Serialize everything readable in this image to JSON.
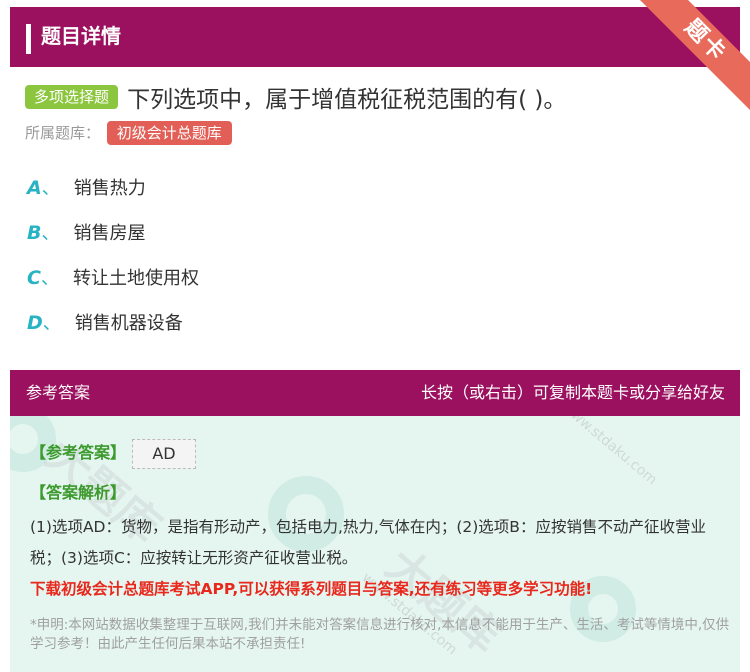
{
  "header": {
    "title": "题目详情"
  },
  "badge": {
    "label": "题卡"
  },
  "question": {
    "type": "多项选择题",
    "text": "下列选项中，属于增值税征税范围的有( )。",
    "bank_label": "所属题库：",
    "bank_name": "初级会计总题库"
  },
  "options": [
    {
      "letter": "A",
      "sep": "、",
      "text": "销售热力"
    },
    {
      "letter": "B",
      "sep": "、",
      "text": "销售房屋"
    },
    {
      "letter": "C",
      "sep": "、",
      "text": "转让土地使用权"
    },
    {
      "letter": "D",
      "sep": "、",
      "text": "销售机器设备"
    }
  ],
  "answer_section": {
    "title": "参考答案",
    "hint": "长按（或右击）可复制本题卡或分享给好友",
    "ref_label": "【参考答案】",
    "ref_value": "AD",
    "exp_label": "【答案解析】",
    "explanation": "(1)选项AD：货物，是指有形动产，包括电力,热力,气体在内；(2)选项B：应按销售不动产征收营业税；(3)选项C：应按转让无形资产征收营业税。",
    "promo": "下载初级会计总题库考试APP,可以获得系列题目与答案,还有练习等更多学习功能!",
    "disclaimer": "*申明:本网站数据收集整理于互联网,我们并未能对答案信息进行核对,本信息不能用于生产、生活、考试等情境中,仅供学习参考！由此产生任何后果本站不承担责任!"
  },
  "watermark": {
    "brand": "大题库",
    "site": "www.stdaku.com"
  },
  "colors": {
    "primary": "#9b1160",
    "accent_green": "#8cc63f",
    "tag_red": "#e15f56",
    "option_teal": "#27b3c4",
    "answer_bg": "#e5f6f0",
    "promo_red": "#e8281c"
  }
}
